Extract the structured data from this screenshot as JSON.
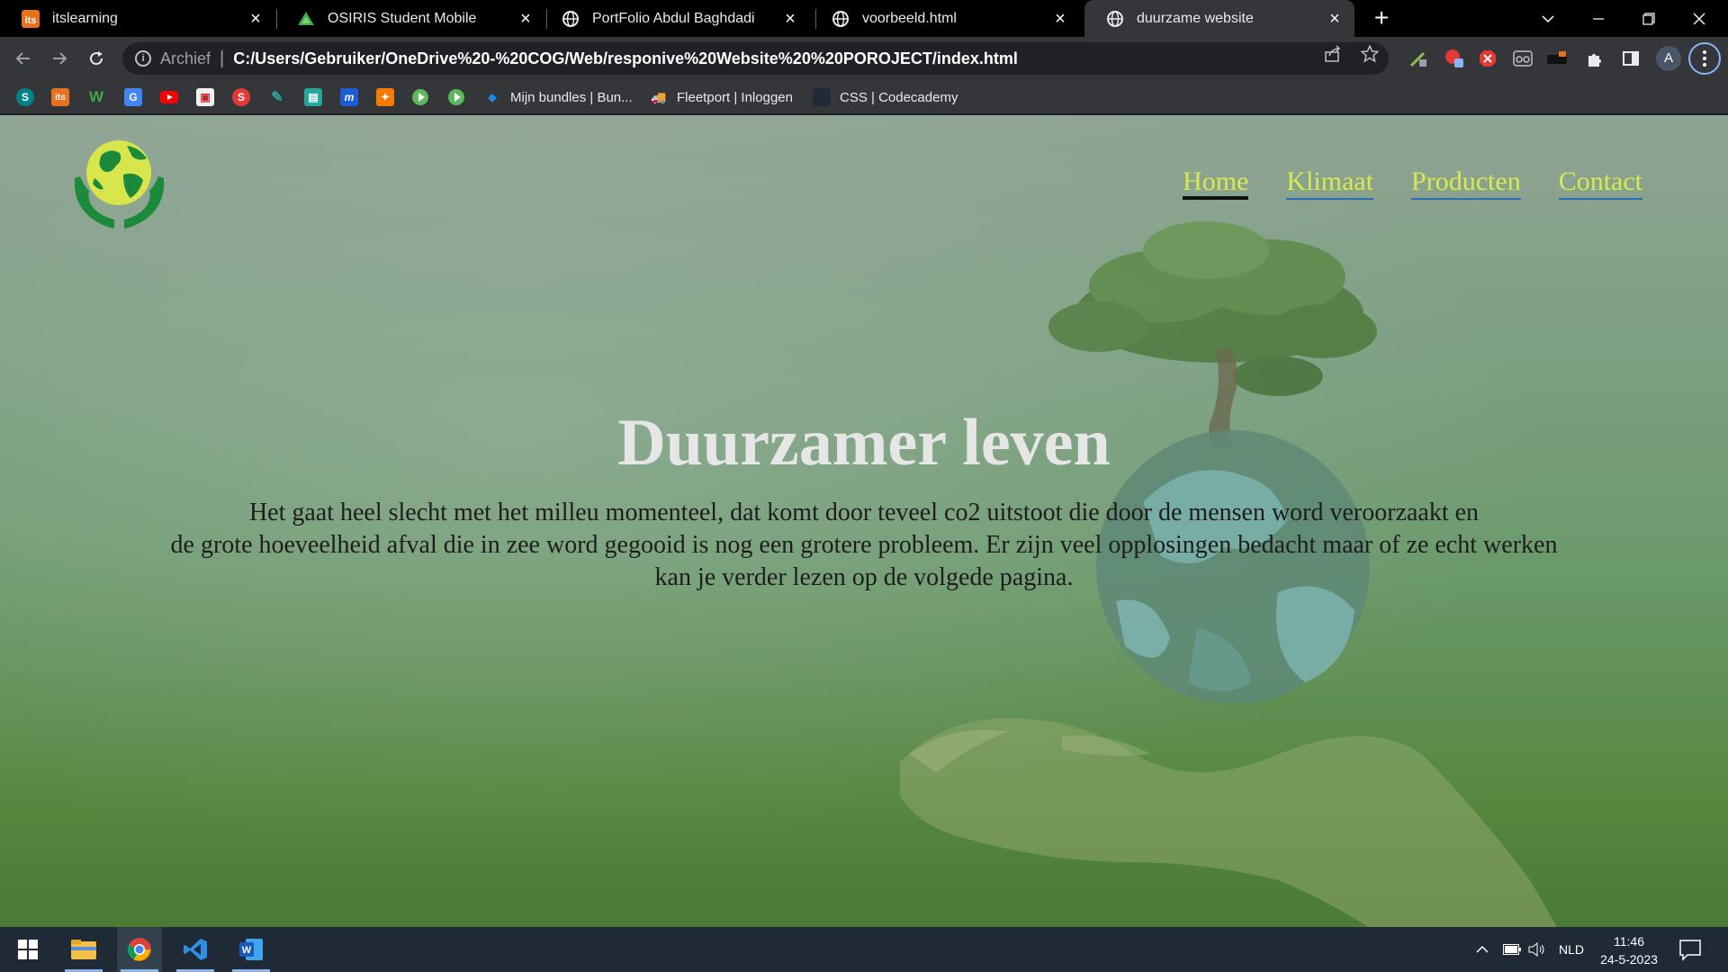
{
  "browser": {
    "tabs": [
      {
        "title": "itslearning",
        "favicon": "its-icon",
        "active": false
      },
      {
        "title": "OSIRIS Student Mobile",
        "favicon": "osiris-icon",
        "active": false
      },
      {
        "title": "PortFolio Abdul Baghdadi",
        "favicon": "globe-icon",
        "active": false
      },
      {
        "title": "voorbeeld.html",
        "favicon": "globe-icon",
        "active": false
      },
      {
        "title": "duurzame website",
        "favicon": "globe-icon",
        "active": true
      }
    ],
    "address": {
      "scheme_label": "Archief",
      "separator": "|",
      "url": "C:/Users/Gebruiker/OneDrive%20-%20COG/Web/responive%20Website%20%20POROJECT/index.html"
    },
    "profile_initial": "A",
    "bookmarks": [
      {
        "label": "Mijn bundles | Bun...",
        "icon": "bundles-icon"
      },
      {
        "label": "Fleetport | Inloggen",
        "icon": "fleetport-icon"
      },
      {
        "label": "CSS | Codecademy",
        "icon": "codecademy-icon"
      }
    ],
    "bookmark_icon_only": [
      "sharepoint-icon",
      "its-icon",
      "w-icon",
      "translate-icon",
      "youtube-icon",
      "app-icon",
      "scribd-icon",
      "pen-icon",
      "app2-icon",
      "m-icon",
      "puzzle-icon",
      "play-icon",
      "play-icon"
    ]
  },
  "site": {
    "nav": [
      {
        "label": "Home",
        "current": true
      },
      {
        "label": "Klimaat",
        "current": false
      },
      {
        "label": "Producten",
        "current": false
      },
      {
        "label": "Contact",
        "current": false
      }
    ],
    "hero_title": "Duurzamer leven",
    "hero_lines": [
      "Het gaat heel slecht met het milleu momenteel, dat komt door teveel co2 uitstoot die door de mensen word veroorzaakt en",
      "de grote hoeveelheid afval die in zee word gegooid is nog een grotere probleem. Er zijn veel opplosingen bedacht maar of ze echt werken",
      "kan je verder lezen op de volgede pagina."
    ],
    "colors": {
      "nav_text": "#d9e94e",
      "nav_underline": "#2a6fb3",
      "title": "#e6e6e6",
      "body_text": "#1d1d1d"
    }
  },
  "taskbar": {
    "apps": [
      "windows-start-icon",
      "file-explorer-icon",
      "chrome-icon",
      "vscode-icon",
      "word-icon"
    ],
    "language": "NLD",
    "time": "11:46",
    "date": "24-5-2023"
  }
}
